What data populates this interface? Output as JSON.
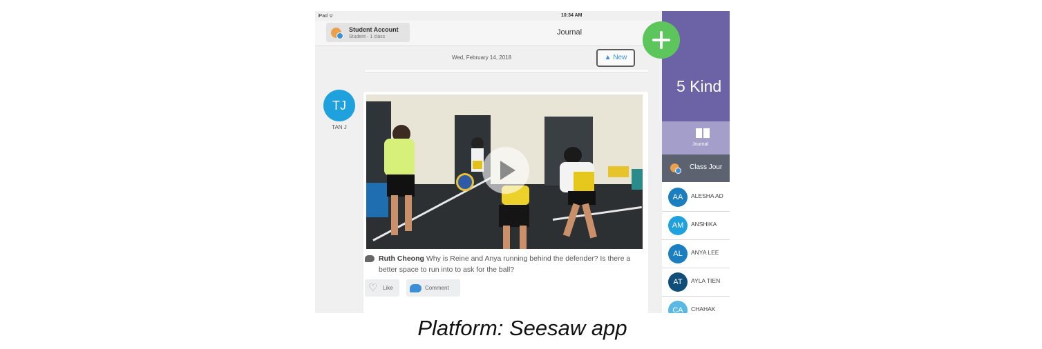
{
  "status_bar": {
    "carrier": "iPad ᯤ",
    "time": "10:34 AM"
  },
  "nav": {
    "account_name": "Student Account",
    "account_sub": "Student - 1 class",
    "title": "Journal"
  },
  "feed": {
    "date": "Wed, February 14, 2018",
    "new_button": "▲ New",
    "post": {
      "author_initials": "TJ",
      "author_name": "TAN J",
      "comment_author": "Ruth Cheong",
      "comment_text": " Why is Reine and Anya running behind the defender? Is there a better space to run into to ask for the ball?",
      "like_label": "Like",
      "comment_label": "Comment"
    }
  },
  "sidebar": {
    "class_name": "5 Kind",
    "journal_tab": "Journal",
    "class_journal": "Class Jour",
    "students": [
      {
        "initials": "AA",
        "name": "ALESHA AD",
        "color": "#1b7fbf"
      },
      {
        "initials": "AM",
        "name": "ANSHIKA",
        "color": "#1ea1dc"
      },
      {
        "initials": "AL",
        "name": "ANYA LEE",
        "color": "#1b7fbf"
      },
      {
        "initials": "AT",
        "name": "AYLA TIEN",
        "color": "#0f4e78"
      },
      {
        "initials": "CA",
        "name": "CHAHAK",
        "color": "#5ab9e3"
      }
    ]
  },
  "caption": "Platform: Seesaw app",
  "colors": {
    "class_header": "#6c63a6",
    "fab": "#5cc65d",
    "accent": "#3b8fd6"
  }
}
